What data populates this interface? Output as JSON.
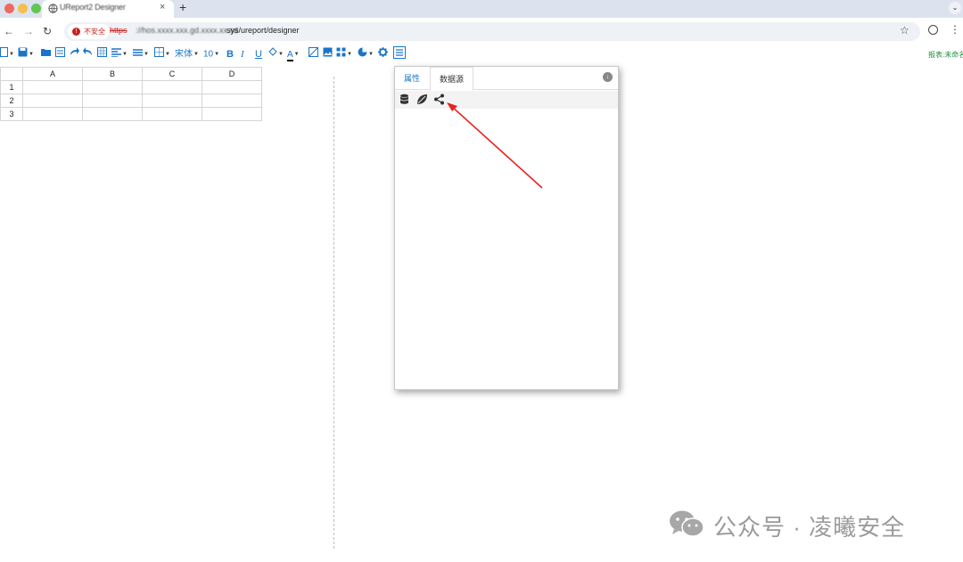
{
  "browser": {
    "tab_title": "UReport2 Designer",
    "tab_close": "×",
    "new_tab": "+",
    "tab_menu": "⌄",
    "back": "←",
    "forward": "→",
    "reload": "↻",
    "security_label": "不安全",
    "url_scheme": "https",
    "url_host": "://hos.xxxx.xxx.gd.xxxx.xx.sd",
    "url_path": "sys/ureport/designer",
    "star": "☆",
    "kebab": "⋮"
  },
  "toolbar": {
    "font_name": "宋体",
    "font_size": "10",
    "bold": "B",
    "italic": "I",
    "underline": "U",
    "font_color": "A",
    "report_name": "报表:未命名"
  },
  "grid": {
    "columns": [
      "A",
      "B",
      "C",
      "D"
    ],
    "rows": [
      "1",
      "2",
      "3"
    ]
  },
  "panel": {
    "tab_properties": "属性",
    "tab_datasource": "数据源"
  },
  "watermark": {
    "text": "公众号 · 凌曦安全"
  },
  "colors": {
    "toolbar_blue": "#1a74c9",
    "annotation_red": "#e8231f"
  }
}
